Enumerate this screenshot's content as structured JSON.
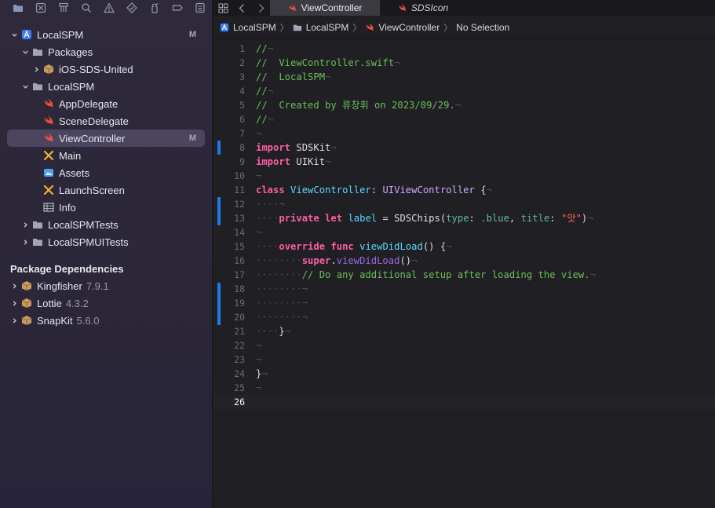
{
  "navigator": {
    "tree": {
      "project": {
        "label": "LocalSPM",
        "badge": "M"
      },
      "packages": {
        "label": "Packages"
      },
      "ios_sds": {
        "label": "iOS-SDS-United"
      },
      "group": {
        "label": "LocalSPM"
      },
      "files": [
        {
          "label": "AppDelegate",
          "badge": ""
        },
        {
          "label": "SceneDelegate",
          "badge": ""
        },
        {
          "label": "ViewController",
          "badge": "M"
        },
        {
          "label": "Main",
          "badge": ""
        },
        {
          "label": "Assets",
          "badge": ""
        },
        {
          "label": "LaunchScreen",
          "badge": ""
        },
        {
          "label": "Info",
          "badge": ""
        }
      ],
      "tests": {
        "label": "LocalSPMTests"
      },
      "uitests": {
        "label": "LocalSPMUITests"
      }
    },
    "package_dependencies": {
      "title": "Package Dependencies",
      "items": [
        {
          "name": "Kingfisher",
          "version": "7.9.1"
        },
        {
          "name": "Lottie",
          "version": "4.3.2"
        },
        {
          "name": "SnapKit",
          "version": "5.6.0"
        }
      ]
    }
  },
  "editor": {
    "tabs": [
      {
        "label": "ViewController",
        "active": true
      },
      {
        "label": "SDSIcon",
        "active": false
      }
    ],
    "jump_bar": [
      "LocalSPM",
      "LocalSPM",
      "ViewController",
      "No Selection"
    ],
    "lines": [
      {
        "n": "1"
      },
      {
        "n": "2"
      },
      {
        "n": "3"
      },
      {
        "n": "4"
      },
      {
        "n": "5"
      },
      {
        "n": "6"
      },
      {
        "n": "7"
      },
      {
        "n": "8"
      },
      {
        "n": "9"
      },
      {
        "n": "10"
      },
      {
        "n": "11"
      },
      {
        "n": "12"
      },
      {
        "n": "13"
      },
      {
        "n": "14"
      },
      {
        "n": "15"
      },
      {
        "n": "16"
      },
      {
        "n": "17"
      },
      {
        "n": "18"
      },
      {
        "n": "19"
      },
      {
        "n": "20"
      },
      {
        "n": "21"
      },
      {
        "n": "22"
      },
      {
        "n": "23"
      },
      {
        "n": "24"
      },
      {
        "n": "25"
      },
      {
        "n": "26"
      }
    ],
    "code": {
      "l1": "//",
      "l2": "//  ViewController.swift",
      "l3": "//  LocalSPM",
      "l4": "//",
      "l5": "//  Created by 류창휘 on 2023/09/29.",
      "l6": "//",
      "import": "import",
      "sdskit": "SDSKit",
      "uikit": "UIKit",
      "class": "class",
      "vc": "ViewController",
      "colon": ":",
      "uivc": "UIViewController",
      "brace_open": " {",
      "private": "private",
      "let": "let",
      "label": "label",
      "eq": " = ",
      "sdschips": "SDSChips",
      "paren": "(",
      "type_arg": "type",
      "blue": ".blue",
      "comma": ", ",
      "title_arg": "title",
      "str": "\"앗\"",
      "close_paren": ")",
      "override": "override",
      "func": "func",
      "viewdidload": "viewDidLoad",
      "parens": "()",
      "super": "super",
      "dot": ".",
      "comment17": "// Do any additional setup after loading the view.",
      "brace_close": "}"
    },
    "current_line": "26"
  }
}
